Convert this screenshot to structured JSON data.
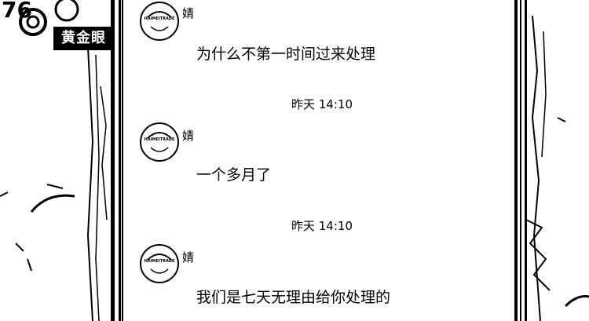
{
  "watermark": {
    "corner_text": "76",
    "brand_text": "黄金眼"
  },
  "messages": [
    {
      "avatar_label": "HAIMEITRADE",
      "sender": "婧",
      "text": "为什么不第一时间过来处理"
    },
    {
      "avatar_label": "HAIMEITRADE",
      "sender": "婧",
      "text": "一个多月了"
    },
    {
      "avatar_label": "HAIMEITRADE",
      "sender": "婧",
      "text": "我们是七天无理由给你处理的"
    }
  ],
  "timestamps": [
    "昨天 14:10",
    "昨天 14:10"
  ]
}
